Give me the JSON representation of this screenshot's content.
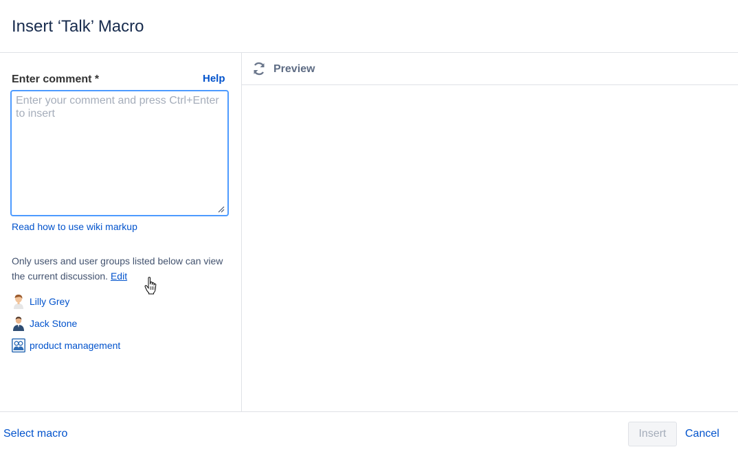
{
  "dialog": {
    "title": "Insert ‘Talk’ Macro"
  },
  "form": {
    "comment_label": "Enter comment *",
    "help_label": "Help",
    "comment_placeholder": "Enter your comment and press Ctrl+Enter to insert",
    "comment_value": "",
    "wiki_link": "Read how to use wiki markup",
    "restriction_text": "Only users and user groups listed below can view the current discussion.",
    "edit_label": "Edit",
    "users": [
      {
        "name": "Lilly Grey",
        "icon": "user-avatar-icon"
      },
      {
        "name": "Jack Stone",
        "icon": "user-avatar-icon"
      },
      {
        "name": "product management",
        "icon": "group-icon"
      }
    ]
  },
  "preview": {
    "label": "Preview",
    "icon": "refresh-icon"
  },
  "footer": {
    "select_macro": "Select macro",
    "insert_label": "Insert",
    "cancel_label": "Cancel"
  },
  "colors": {
    "link": "#0052cc",
    "focus_border": "#4c9aff",
    "title": "#172b4d",
    "disabled_text": "#a5adba"
  }
}
